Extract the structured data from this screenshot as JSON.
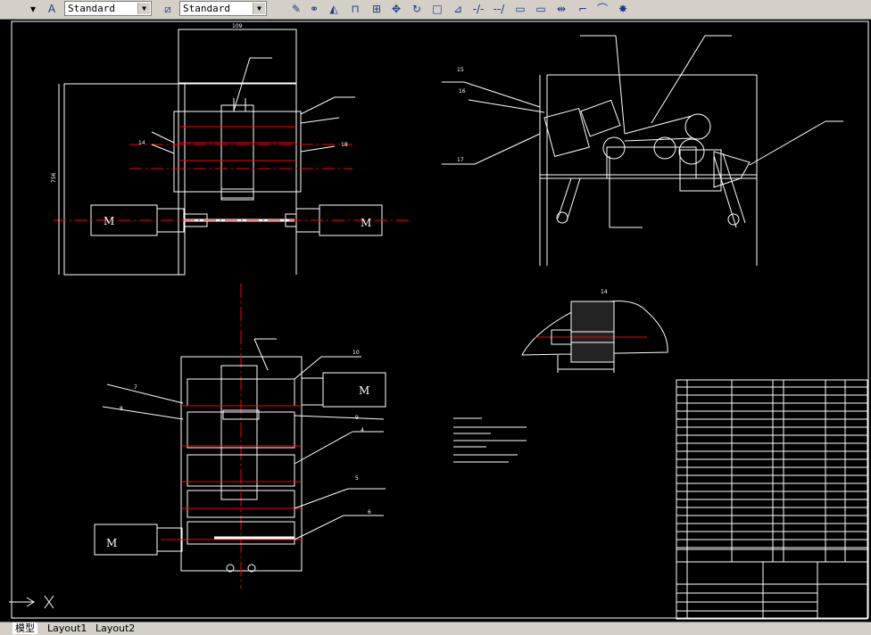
{
  "toolbar": {
    "text_style": "Standard",
    "dim_style": "Standard",
    "icons": [
      "pencil-icon",
      "snap-icon",
      "mirror-icon",
      "offset-icon",
      "array-icon",
      "move-icon",
      "rotate-icon",
      "scale-icon",
      "stretch-icon",
      "trim-icon",
      "extend-icon",
      "break-icon",
      "break-at-point-icon",
      "join-icon",
      "chamfer-icon",
      "fillet-icon",
      "explode-icon"
    ]
  },
  "tabs": [
    "模型",
    "Layout1",
    "Layout2"
  ],
  "drawing": {
    "motor": "M",
    "dim_top": "109",
    "dim_side": "756",
    "labels_top_view": [
      "14",
      "18"
    ],
    "labels_side_view": [
      "15",
      "16",
      "17"
    ],
    "labels_front_view": [
      "7",
      "8",
      "9",
      "10",
      "4",
      "5",
      "6"
    ],
    "label_detail": "14"
  }
}
